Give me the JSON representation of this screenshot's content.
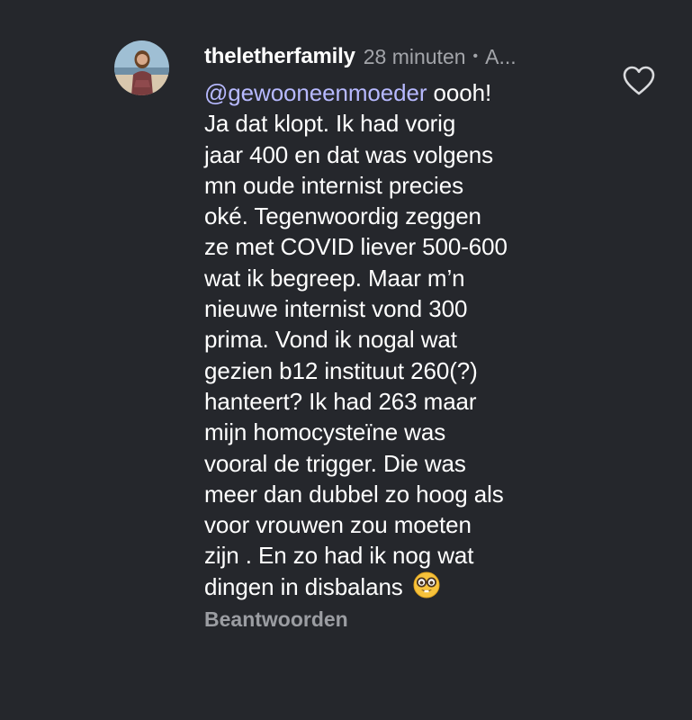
{
  "comment": {
    "username": "theletherfamily",
    "time": "28 minuten",
    "separator": "•",
    "more": "A...",
    "mention": "@gewooneenmoeder",
    "text": " oooh!\nJa dat klopt. Ik had vorig\njaar 400 en dat was volgens\nmn oude internist precies\noké. Tegenwoordig zeggen\nze met COVID liever 500-600\nwat ik begreep. Maar m’n\nnieuwe internist vond 300\nprima. Vond ik nogal wat\ngezien b12 instituut 260(?)\nhanteert? Ik had 263 maar\nmijn homocysteïne was\nvooral de trigger. Die was\nmeer dan dubbel zo hoog als\nvoor vrouwen zou moeten\nzijn . En zo had ik nog wat\ndingen in disbalans ",
    "emoji_icon": "nerd-face-icon",
    "reply_label": "Beantwoorden",
    "like_icon": "heart-outline-icon"
  },
  "colors": {
    "background": "#25272c",
    "text": "#ffffff",
    "muted": "#a3a5aa",
    "mention": "#b7b9ff"
  }
}
